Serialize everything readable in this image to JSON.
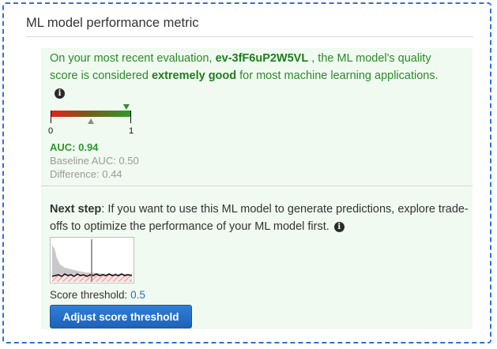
{
  "section": {
    "title": "ML model performance metric"
  },
  "evaluation": {
    "text_before_id": "On your most recent evaluation, ",
    "evaluation_id": "ev-3fF6uP2W5VL",
    "text_after_id": " , the ML model's quality score is considered ",
    "quality": "extremely good",
    "text_end": " for most machine learning applications.",
    "info_icon": "info-icon"
  },
  "gauge": {
    "min_label": "0",
    "max_label": "1",
    "model_auc": 0.94,
    "baseline_auc": 0.5,
    "gradient_colors": [
      "#e8201a",
      "#2e9a2e"
    ],
    "marker_color": "#2a8f2a",
    "baseline_marker_color": "#8a8a8a"
  },
  "metrics": {
    "auc": "AUC: 0.94",
    "baseline_auc": "Baseline AUC: 0.50",
    "difference": "Difference: 0.44"
  },
  "next_step": {
    "label": "Next step",
    "text": ": If you want to use this ML model to generate predictions, explore trade-offs to optimize the performance of your ML model first.",
    "info_icon": "info-icon"
  },
  "threshold": {
    "label": "Score threshold: ",
    "value": "0.5",
    "button_label": "Adjust score threshold"
  },
  "colors": {
    "frame_border": "#2e6fe0",
    "panel_bg": "#f0faf0",
    "good_text": "#2b8a2b",
    "link_blue": "#2a6ebb",
    "button_bg": "#1d63b8"
  }
}
